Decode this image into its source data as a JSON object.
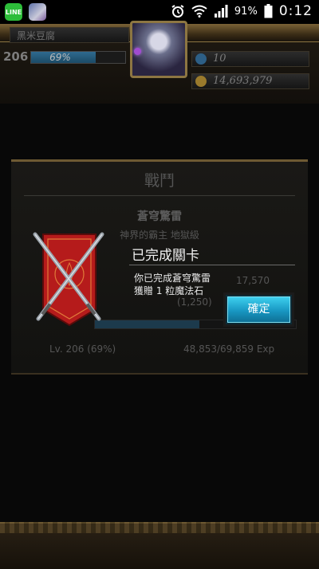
{
  "status_bar": {
    "battery": "91%",
    "time": "0:12",
    "line_icon_label": "LINE"
  },
  "header": {
    "player_name": "黑米豆腐",
    "level": "206",
    "exp_percent": "69%",
    "exp_fraction": 0.69,
    "stamina": "10",
    "gold": "14,693,979"
  },
  "battle_panel": {
    "title": "戰鬥",
    "stage_name": "蒼穹驚雷",
    "stage_sub": "神界的霸主 地獄級",
    "ghost_value": "17,570",
    "ghost_label": "(1,250)",
    "level_info": "Lv. 206 (69%)",
    "exp_info": "48,853/69,859 Exp"
  },
  "dialog": {
    "title": "已完成關卡",
    "message_line1": "你已完成蒼穹驚雷",
    "message_line2": "獲贈 1 粒魔法石",
    "confirm_label": "確定"
  },
  "colors": {
    "accent_button": "#1fa9d4",
    "gold_frame": "#8d7642",
    "banner_red": "#b51b1b"
  }
}
